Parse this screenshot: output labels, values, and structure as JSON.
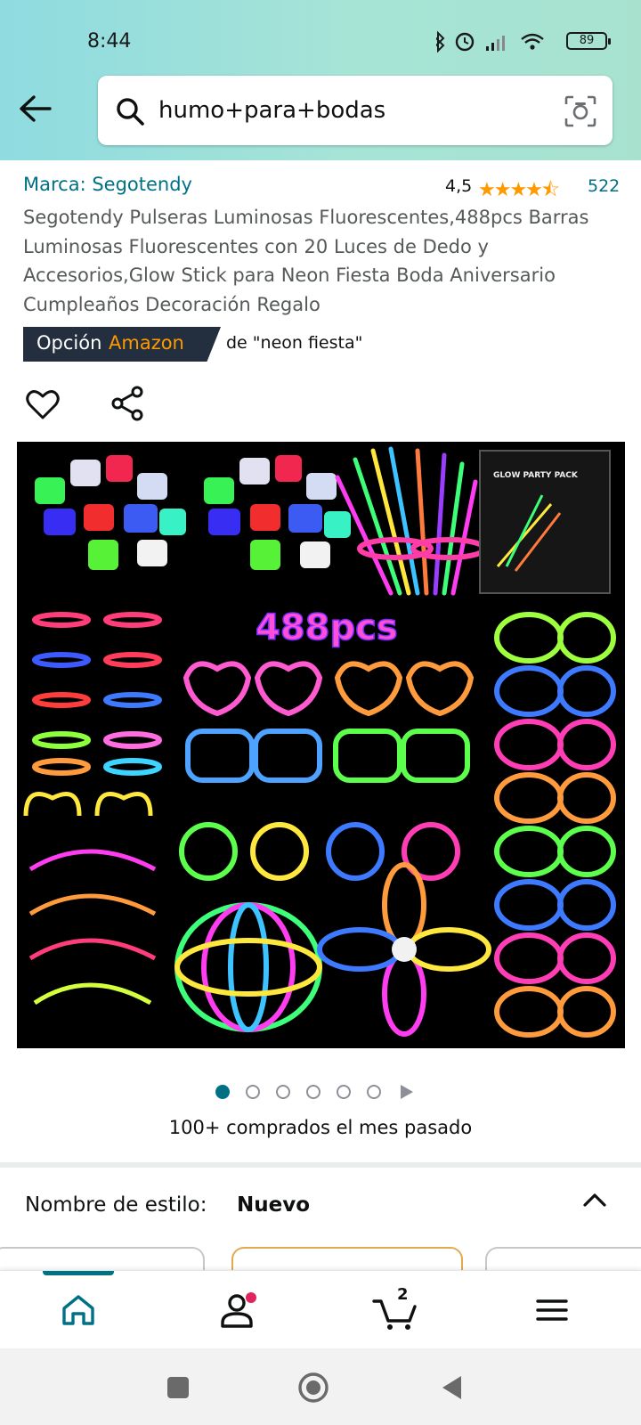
{
  "status_bar": {
    "time": "8:44",
    "battery": "89"
  },
  "search": {
    "query": "humo+para+bodas"
  },
  "product": {
    "brand": "Marca: Segotendy",
    "rating": "4,5",
    "reviews": "522",
    "title": "Segotendy Pulseras Luminosas Fluorescentes,488pcs Barras Luminosas Fluorescentes con 20 Luces de Dedo y Accesorios,Glow Stick para Neon Fiesta Boda Aniversario Cumpleaños Decoración Regalo",
    "badge_prefix": "Opción",
    "badge_brand": "Amazon",
    "badge_sub": "de \"neon fiesta\"",
    "image_text": "488pcs",
    "box_text": "GLOW PARTY PACK",
    "purchased": "100+ comprados el mes pasado"
  },
  "style": {
    "label": "Nombre de estilo:",
    "value": "Nuevo"
  },
  "carousel": {
    "total": 6,
    "active": 1
  },
  "bottom_nav": {
    "cart_count": "2"
  },
  "colors": {
    "accent": "#007185",
    "star": "#ff9900",
    "badge_bg": "#232f3e"
  }
}
